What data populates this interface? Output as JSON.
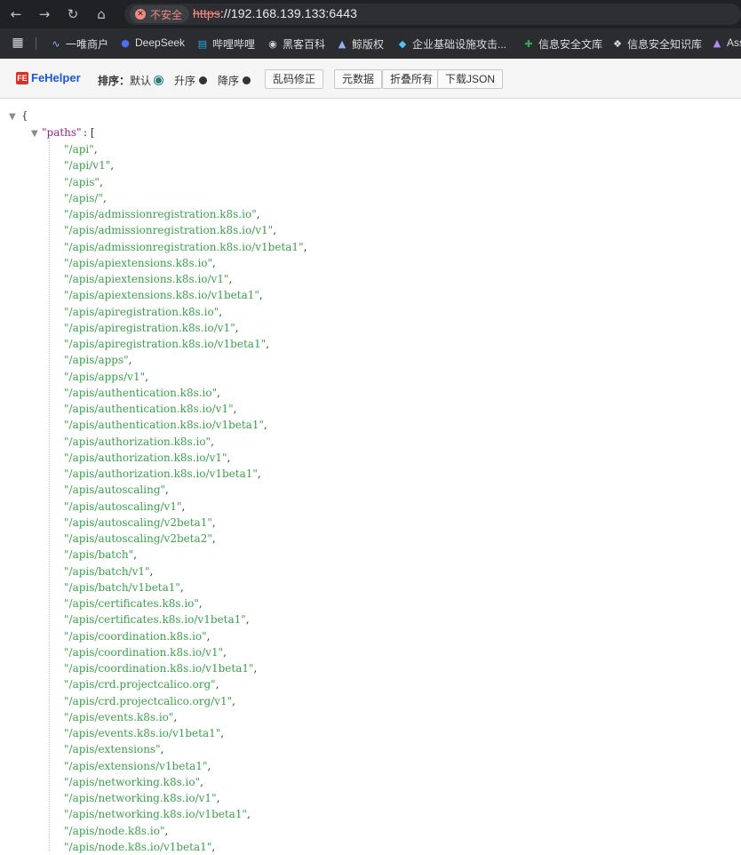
{
  "browser": {
    "insecure_label": "不安全",
    "url_scheme": "https",
    "url_rest": "://192.168.139.133:6443"
  },
  "bookmarks": [
    {
      "label": "一唯商户",
      "icon": "link-icon"
    },
    {
      "label": "DeepSeek",
      "icon": "deepseek-icon"
    },
    {
      "label": "哔哩哔哩",
      "icon": "bilibili-icon"
    },
    {
      "label": "黑客百科",
      "icon": "globe-icon"
    },
    {
      "label": "鲸版权",
      "icon": "whale-icon"
    },
    {
      "label": "企业基础设施攻击...",
      "icon": "cube-icon"
    },
    {
      "label": "信息安全文库",
      "icon": "plus-shield-icon"
    },
    {
      "label": "信息安全知识库",
      "icon": "diamond-icon"
    },
    {
      "label": "Ass",
      "icon": "triangle-icon"
    }
  ],
  "fehelper": {
    "brand": "FeHelper",
    "sort_label": "排序：",
    "opt_default": "默认",
    "opt_asc": "升序",
    "opt_desc": "降序",
    "btn_fix": "乱码修正",
    "btn_raw": "元数据",
    "btn_collapse": "折叠所有",
    "btn_download": "下载JSON"
  },
  "json": {
    "open_brace": "{",
    "key": "\"paths\"",
    "after_key": ": [",
    "paths": [
      "/api",
      "/api/v1",
      "/apis",
      "/apis/",
      "/apis/admissionregistration.k8s.io",
      "/apis/admissionregistration.k8s.io/v1",
      "/apis/admissionregistration.k8s.io/v1beta1",
      "/apis/apiextensions.k8s.io",
      "/apis/apiextensions.k8s.io/v1",
      "/apis/apiextensions.k8s.io/v1beta1",
      "/apis/apiregistration.k8s.io",
      "/apis/apiregistration.k8s.io/v1",
      "/apis/apiregistration.k8s.io/v1beta1",
      "/apis/apps",
      "/apis/apps/v1",
      "/apis/authentication.k8s.io",
      "/apis/authentication.k8s.io/v1",
      "/apis/authentication.k8s.io/v1beta1",
      "/apis/authorization.k8s.io",
      "/apis/authorization.k8s.io/v1",
      "/apis/authorization.k8s.io/v1beta1",
      "/apis/autoscaling",
      "/apis/autoscaling/v1",
      "/apis/autoscaling/v2beta1",
      "/apis/autoscaling/v2beta2",
      "/apis/batch",
      "/apis/batch/v1",
      "/apis/batch/v1beta1",
      "/apis/certificates.k8s.io",
      "/apis/certificates.k8s.io/v1beta1",
      "/apis/coordination.k8s.io",
      "/apis/coordination.k8s.io/v1",
      "/apis/coordination.k8s.io/v1beta1",
      "/apis/crd.projectcalico.org",
      "/apis/crd.projectcalico.org/v1",
      "/apis/events.k8s.io",
      "/apis/events.k8s.io/v1beta1",
      "/apis/extensions",
      "/apis/extensions/v1beta1",
      "/apis/networking.k8s.io",
      "/apis/networking.k8s.io/v1",
      "/apis/networking.k8s.io/v1beta1",
      "/apis/node.k8s.io",
      "/apis/node.k8s.io/v1beta1"
    ]
  }
}
